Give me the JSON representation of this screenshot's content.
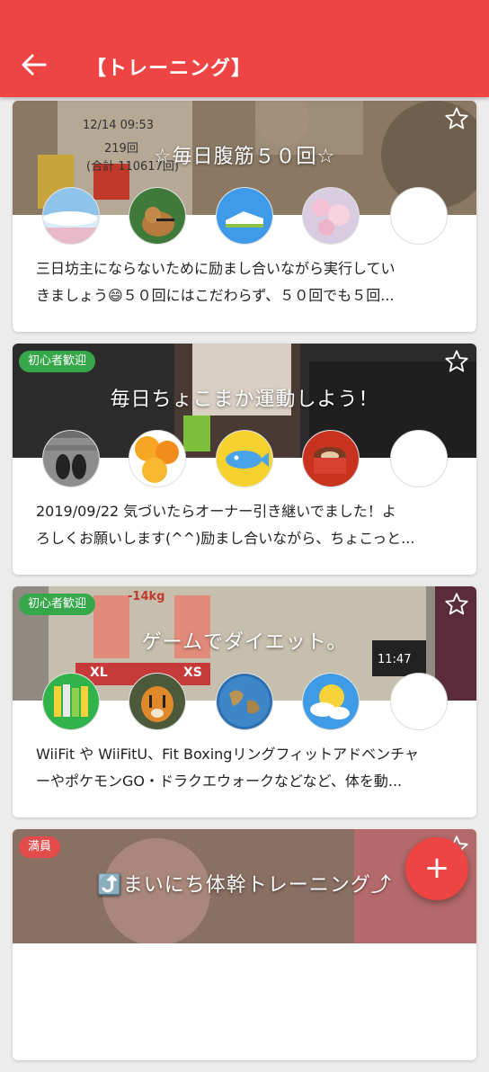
{
  "header": {
    "title": "【トレーニング】",
    "back_icon": "arrow-back-icon",
    "background": "#ef4444"
  },
  "cards": [
    {
      "title": "☆毎日腹筋５０回☆",
      "badge": "",
      "favorite_icon": "star-outline-icon",
      "description_lines": [
        "三日坊主にならないために励まし合いながら実行してい",
        "きましょう😄５０回にはこだわらず、５０回でも５回..."
      ],
      "banner_texts": [
        "12/14 09:53",
        "219回",
        "(合計 110617回)"
      ],
      "avatars": [
        "cloud-sky",
        "chipmunk",
        "sneaker",
        "cherry-blossom",
        "empty"
      ]
    },
    {
      "title": "毎日ちょこまか運動しよう！",
      "badge": "初心者歓迎",
      "favorite_icon": "star-outline-icon",
      "description_lines": [
        "2019/09/22 気づいたらオーナー引き継いでました！よ",
        "ろしくお願いします(^^)励まし合いながら、ちょこっと..."
      ],
      "avatars": [
        "sneakers-on-wood",
        "orange-slices",
        "fish-character",
        "coffee-cup",
        "empty"
      ]
    },
    {
      "title": "ゲームでダイエット。",
      "badge": "初心者歓迎",
      "favorite_icon": "star-outline-icon",
      "description_lines": [
        "WiiFit や WiiFitU、Fit Boxingリングフィットアドベンチャ",
        "ーやポケモンGO・ドラクエウォークなどなど、体を動..."
      ],
      "banner_texts": [
        "-14kg",
        "XL",
        "XS",
        "11:47"
      ],
      "avatars": [
        "books",
        "tiger",
        "globe",
        "sun-cloud",
        "empty"
      ]
    },
    {
      "title": "⤴️まいにち体幹トレーニング⤴",
      "badge": "満員",
      "favorite_icon": "star-outline-icon",
      "description_lines": [],
      "avatars": []
    }
  ],
  "fab": {
    "label": "+",
    "icon": "add-icon"
  }
}
